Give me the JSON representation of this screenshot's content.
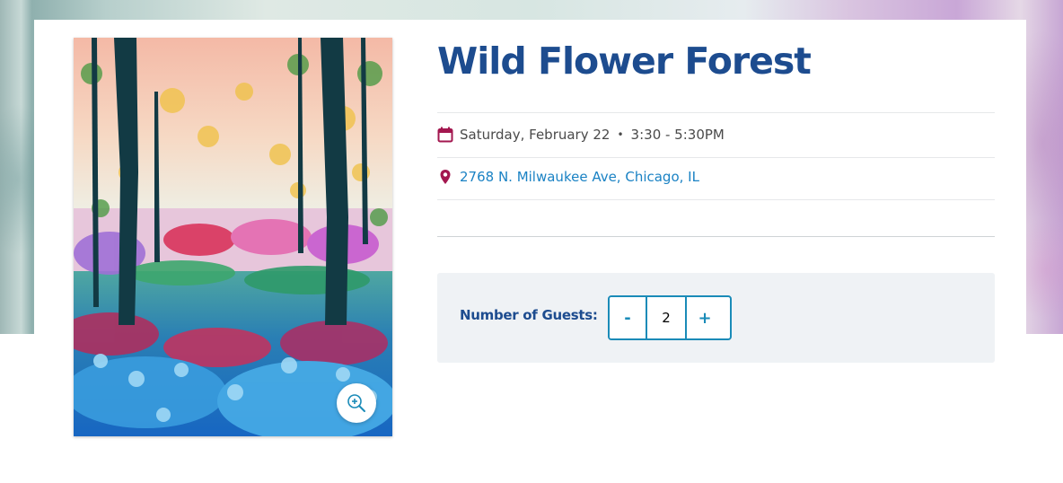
{
  "event": {
    "title": "Wild Flower Forest",
    "date": "Saturday, February 22",
    "separator": "•",
    "time": "3:30 - 5:30PM",
    "address": "2768 N. Milwaukee Ave, Chicago, IL"
  },
  "guests": {
    "label": "Number of Guests:",
    "decrement_label": "-",
    "increment_label": "+",
    "value": "2"
  },
  "icons": {
    "calendar": "calendar-icon",
    "location": "map-pin-icon",
    "zoom": "zoom-in-icon"
  },
  "colors": {
    "brand_blue": "#1d4c8f",
    "link_blue": "#1a82c4",
    "stepper_teal": "#1a8bb8",
    "icon_magenta": "#a3174f",
    "guest_panel_bg": "#eff2f5"
  }
}
